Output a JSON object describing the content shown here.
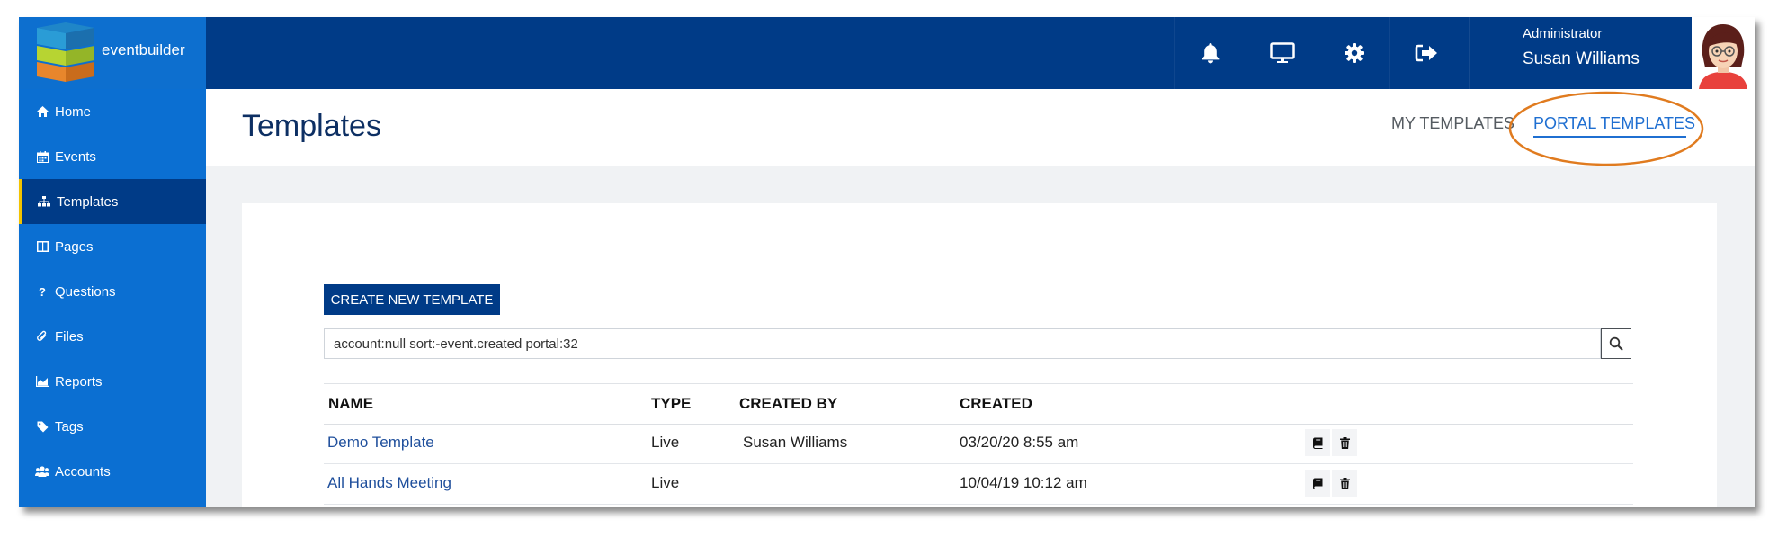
{
  "brand": {
    "name": "eventbuilder"
  },
  "topbar": {
    "icons": [
      "bell-icon",
      "monitor-icon",
      "gear-icon",
      "sign-out-icon"
    ],
    "user": {
      "role": "Administrator",
      "name": "Susan Williams"
    }
  },
  "sidebar": {
    "items": [
      {
        "label": "Home",
        "icon": "home-icon"
      },
      {
        "label": "Events",
        "icon": "calendar-icon"
      },
      {
        "label": "Templates",
        "icon": "sitemap-icon",
        "active": true
      },
      {
        "label": "Pages",
        "icon": "columns-icon"
      },
      {
        "label": "Questions",
        "icon": "question-icon"
      },
      {
        "label": "Files",
        "icon": "paperclip-icon"
      },
      {
        "label": "Reports",
        "icon": "chart-icon"
      },
      {
        "label": "Tags",
        "icon": "tag-icon"
      },
      {
        "label": "Accounts",
        "icon": "users-icon"
      }
    ]
  },
  "header": {
    "title": "Templates",
    "tabs": [
      {
        "label": "MY TEMPLATES",
        "active": false
      },
      {
        "label": "PORTAL TEMPLATES",
        "active": true
      }
    ]
  },
  "main": {
    "create_button": "CREATE NEW TEMPLATE",
    "search": {
      "value": "account:null sort:-event.created portal:32",
      "placeholder": ""
    },
    "table": {
      "columns": [
        "NAME",
        "TYPE",
        "CREATED BY",
        "CREATED"
      ],
      "rows": [
        {
          "name": "Demo Template",
          "type": "Live",
          "created_by": "Susan Williams",
          "created": "03/20/20 8:55 am"
        },
        {
          "name": "All Hands Meeting",
          "type": "Live",
          "created_by": "",
          "created": "10/04/19 10:12 am"
        }
      ]
    }
  },
  "colors": {
    "topbar": "#003b87",
    "sidebar": "#0b6fd2",
    "accent": "#f2c300",
    "highlight": "#e07b1f",
    "link": "#1f4f9c"
  }
}
